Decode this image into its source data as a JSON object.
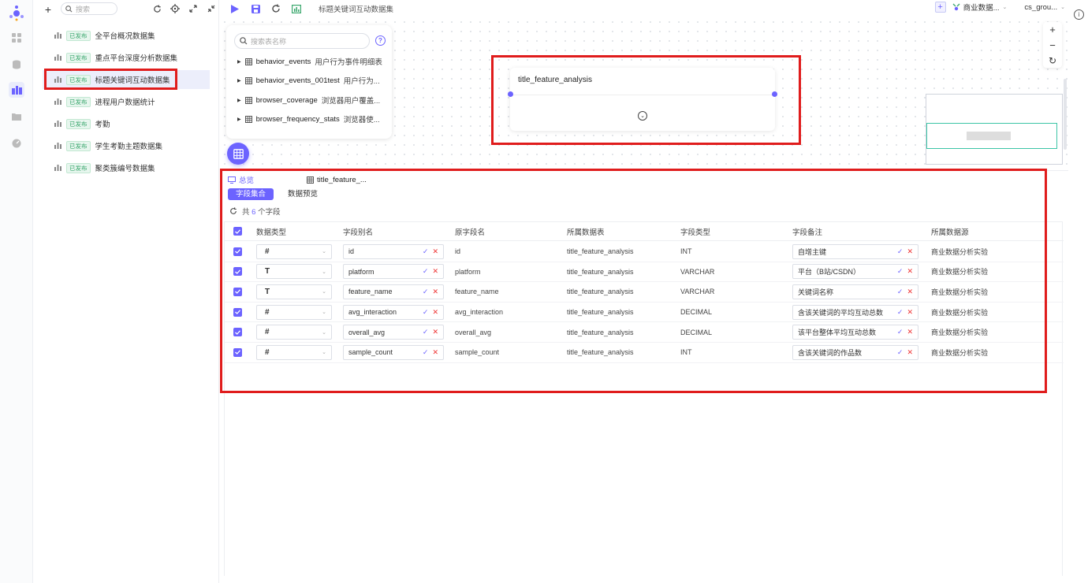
{
  "list": {
    "search_placeholder": "搜索",
    "add_label": "+",
    "items": [
      {
        "tag": "已发布",
        "name": "全平台概况数据集"
      },
      {
        "tag": "已发布",
        "name": "重点平台深度分析数据集"
      },
      {
        "tag": "已发布",
        "name": "标题关键词互动数据集"
      },
      {
        "tag": "已发布",
        "name": "进程用户数据统计"
      },
      {
        "tag": "已发布",
        "name": "考勤"
      },
      {
        "tag": "已发布",
        "name": "学生考勤主题数据集"
      },
      {
        "tag": "已发布",
        "name": "聚类簇编号数据集"
      }
    ]
  },
  "toolbar": {
    "title": "标题关键词互动数据集",
    "datasource": "商业数据...",
    "group": "cs_grou..."
  },
  "table_popup": {
    "search_placeholder": "搜索表名称",
    "help_label": "?",
    "tables": [
      {
        "name": "behavior_events",
        "desc": "用户行为事件明细表"
      },
      {
        "name": "behavior_events_001test",
        "desc": "用户行为..."
      },
      {
        "name": "browser_coverage",
        "desc": "浏览器用户覆盖..."
      },
      {
        "name": "browser_frequency_stats",
        "desc": "浏览器使..."
      }
    ]
  },
  "node": {
    "title": "title_feature_analysis"
  },
  "zoom": {
    "plus": "+",
    "minus": "−",
    "reset": "↻"
  },
  "bottom": {
    "tab_overview": "总览",
    "tab_table": "title_feature_...",
    "subtab_fields": "字段集合",
    "subtab_preview": "数据预览",
    "count_prefix": "共",
    "count": "6",
    "count_suffix": "个字段",
    "columns": [
      "数据类型",
      "字段别名",
      "原字段名",
      "所属数据表",
      "字段类型",
      "字段备注",
      "所属数据源"
    ],
    "rows": [
      {
        "type": "#",
        "alias": "id",
        "orig": "id",
        "table": "title_feature_analysis",
        "ftype": "INT",
        "remark": "自增主键",
        "source": "商业数据分析实验"
      },
      {
        "type": "T",
        "alias": "platform",
        "orig": "platform",
        "table": "title_feature_analysis",
        "ftype": "VARCHAR",
        "remark": "平台（B站/CSDN）",
        "source": "商业数据分析实验"
      },
      {
        "type": "T",
        "alias": "feature_name",
        "orig": "feature_name",
        "table": "title_feature_analysis",
        "ftype": "VARCHAR",
        "remark": "关键词名称",
        "source": "商业数据分析实验"
      },
      {
        "type": "#",
        "alias": "avg_interaction",
        "orig": "avg_interaction",
        "table": "title_feature_analysis",
        "ftype": "DECIMAL",
        "remark": "含该关键词的平均互动总数",
        "source": "商业数据分析实验"
      },
      {
        "type": "#",
        "alias": "overall_avg",
        "orig": "overall_avg",
        "table": "title_feature_analysis",
        "ftype": "DECIMAL",
        "remark": "该平台整体平均互动总数",
        "source": "商业数据分析实验"
      },
      {
        "type": "#",
        "alias": "sample_count",
        "orig": "sample_count",
        "table": "title_feature_analysis",
        "ftype": "INT",
        "remark": "含该关键词的作品数",
        "source": "商业数据分析实验"
      }
    ]
  },
  "colors": {
    "accent": "#6c63ff",
    "highlight": "#e01c1c",
    "published": "#3aa76d"
  }
}
